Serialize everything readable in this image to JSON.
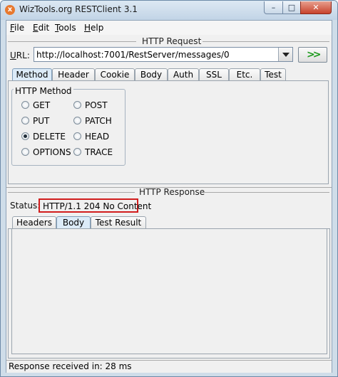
{
  "window": {
    "title": "WizTools.org RESTClient 3.1",
    "icon": "x-app-icon",
    "controls": {
      "minimize": "–",
      "maximize": "□",
      "close": "✕"
    }
  },
  "menu": [
    {
      "label": "File",
      "mnemonic": "F"
    },
    {
      "label": "Edit",
      "mnemonic": "E"
    },
    {
      "label": "Tools",
      "mnemonic": "T"
    },
    {
      "label": "Help",
      "mnemonic": "H"
    }
  ],
  "request": {
    "section_title": "HTTP Request",
    "url_label": "URL:",
    "url_value": "http://localhost:7001/RestServer/messages/0",
    "go_label": ">>",
    "tabs": [
      "Method",
      "Header",
      "Cookie",
      "Body",
      "Auth",
      "SSL",
      "Etc.",
      "Test"
    ],
    "selected_tab": "Method",
    "method_group_title": "HTTP Method",
    "methods": [
      "GET",
      "POST",
      "PUT",
      "PATCH",
      "DELETE",
      "HEAD",
      "OPTIONS",
      "TRACE"
    ],
    "selected_method": "DELETE"
  },
  "response": {
    "section_title": "HTTP Response",
    "status_label": "Status:",
    "status_value": "HTTP/1.1 204 No Content",
    "tabs": [
      "Headers",
      "Body",
      "Test Result"
    ],
    "selected_tab": "Body",
    "highlight_color": "#d11d1d"
  },
  "statusbar": {
    "text": "Response received in: 28 ms"
  }
}
